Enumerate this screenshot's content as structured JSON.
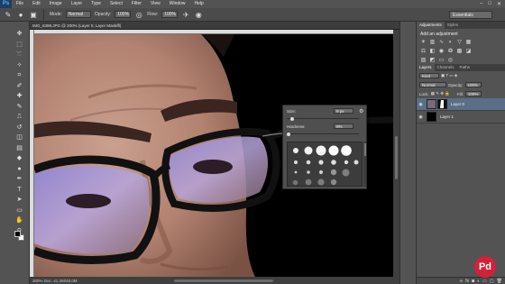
{
  "menu": {
    "logo": "Ps",
    "items": [
      "File",
      "Edit",
      "Image",
      "Layer",
      "Type",
      "Select",
      "Filter",
      "View",
      "Window",
      "Help"
    ]
  },
  "options": {
    "mode_label": "Mode:",
    "mode_value": "Normal",
    "opacity_label": "Opacity:",
    "opacity_value": "100%",
    "flow_label": "Flow:",
    "flow_value": "100%",
    "workspace": "Essentials"
  },
  "document": {
    "tab_title": "IMG_6399.JPG @ 200% (Layer 0, Layer Mask/8)",
    "status": "200%   Doc: 41.2M/48.0M"
  },
  "brush_picker": {
    "size_label": "Size:",
    "size_value": "9 px",
    "size_level": 0.05,
    "hardness_label": "Hardness:",
    "hardness_value": "0%",
    "hardness_level": 0.0
  },
  "adjustments": {
    "tabs": [
      "Adjustments",
      "Styles"
    ],
    "title": "Add an adjustment",
    "icons": [
      "brightness-icon",
      "levels-icon",
      "curves-icon",
      "exposure-icon",
      "vibrance-icon",
      "hue-icon",
      "color-balance-icon",
      "bw-icon",
      "photo-filter-icon",
      "channel-mixer-icon",
      "lookup-icon",
      "invert-icon",
      "posterize-icon",
      "threshold-icon",
      "gradient-map-icon",
      "selective-color-icon"
    ]
  },
  "layers": {
    "tabs": [
      "Layers",
      "Channels",
      "Paths"
    ],
    "kind_label": "Kind",
    "blend_value": "Normal",
    "opacity_label": "Opacity:",
    "opacity_value": "100%",
    "lock_label": "Lock:",
    "fill_label": "Fill:",
    "fill_value": "100%",
    "items": [
      {
        "name": "Layer 0",
        "selected": true
      },
      {
        "name": "Layer 1",
        "selected": false
      }
    ]
  },
  "watermark": "Pd",
  "colors": {
    "selection": "#5a6f87",
    "logo": "#d3213a"
  }
}
